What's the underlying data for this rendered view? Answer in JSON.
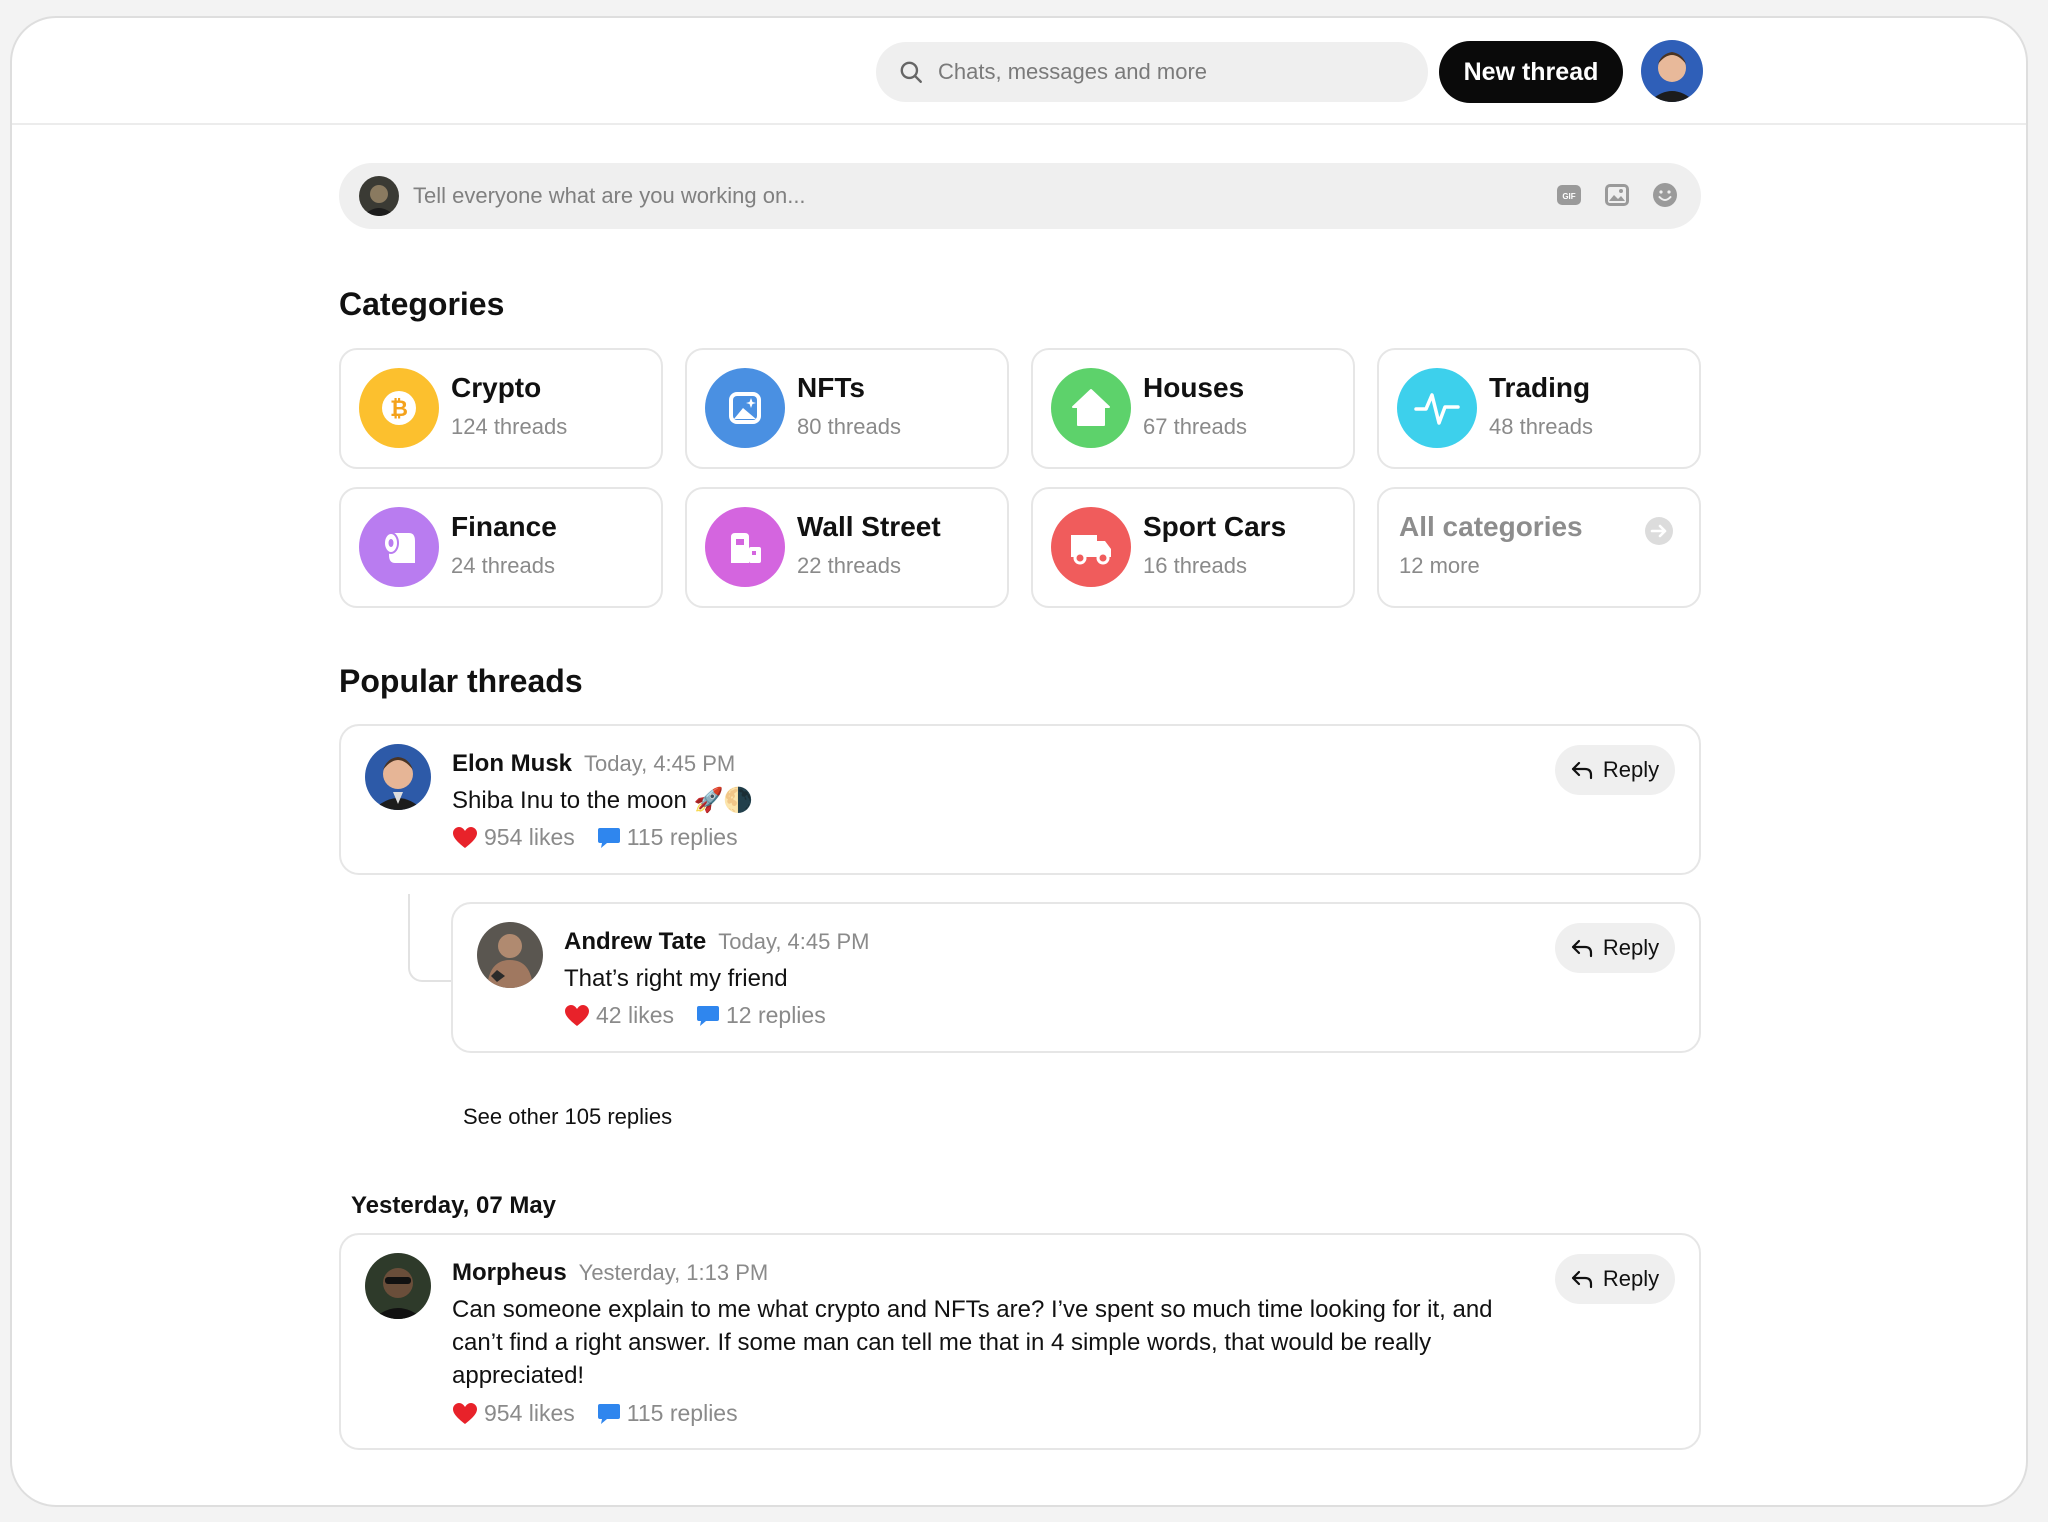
{
  "search": {
    "placeholder": "Chats, messages and more"
  },
  "header": {
    "new_thread_label": "New thread"
  },
  "composer": {
    "placeholder": "Tell everyone what are you working on...",
    "gif_label": "GIF"
  },
  "categories": {
    "title": "Categories",
    "items": [
      {
        "name": "Crypto",
        "count": "124 threads",
        "color": "#FCC02E",
        "icon": "bitcoin-icon"
      },
      {
        "name": "NFTs",
        "count": "80 threads",
        "color": "#4A90E2",
        "icon": "image-sparkle-icon"
      },
      {
        "name": "Houses",
        "count": "67 threads",
        "color": "#5DD26B",
        "icon": "house-icon"
      },
      {
        "name": "Trading",
        "count": "48 threads",
        "color": "#3DD0EC",
        "icon": "pulse-icon"
      },
      {
        "name": "Finance",
        "count": "24 threads",
        "color": "#B97CF0",
        "icon": "toilet-paper-icon"
      },
      {
        "name": "Wall Street",
        "count": "22 threads",
        "color": "#D465DF",
        "icon": "building-icon"
      },
      {
        "name": "Sport Cars",
        "count": "16 threads",
        "color": "#F05C5C",
        "icon": "truck-icon"
      }
    ],
    "all": {
      "name": "All categories",
      "count": "12 more"
    }
  },
  "popular": {
    "title": "Popular threads",
    "threads": [
      {
        "author": "Elon Musk",
        "time": "Today, 4:45 PM",
        "message": "Shiba Inu to the moon 🚀🌗",
        "likes": "954 likes",
        "replies": "115 replies",
        "reply_label": "Reply"
      },
      {
        "author": "Andrew Tate",
        "time": "Today, 4:45 PM",
        "message": "That’s right my friend",
        "likes": "42 likes",
        "replies": "12 replies",
        "reply_label": "Reply"
      }
    ],
    "see_other": "See other 105 replies"
  },
  "yesterday": {
    "date_label": "Yesterday, 07 May",
    "thread": {
      "author": "Morpheus",
      "time": "Yesterday, 1:13 PM",
      "message": "Can someone explain to me what crypto and NFTs are? I’ve spent so much time looking for it, and can’t find a right answer. If some man can tell me that in 4 simple words, that would be really appreciated!",
      "likes": "954 likes",
      "replies": "115 replies",
      "reply_label": "Reply"
    }
  },
  "colors": {
    "like": "#E8222A",
    "reply_bubble": "#2F86EE",
    "accent_dark": "#0A0A0A"
  }
}
